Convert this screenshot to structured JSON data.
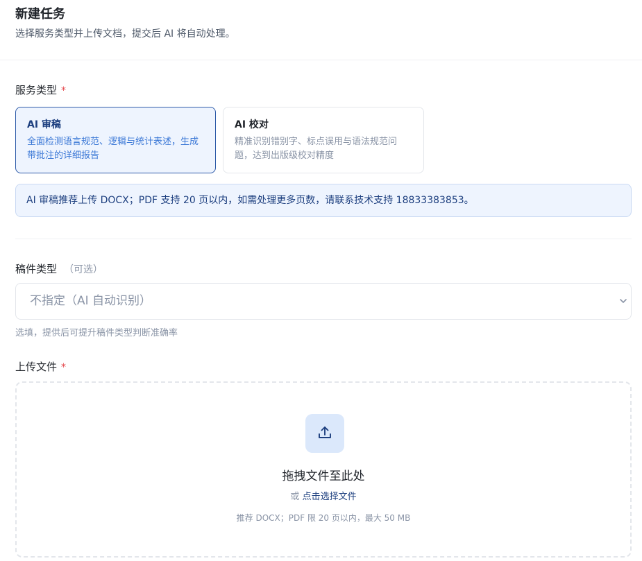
{
  "header": {
    "title": "新建任务",
    "subtitle": "选择服务类型并上传文档，提交后 AI 将自动处理。"
  },
  "service": {
    "label": "服务类型",
    "required_mark": "*",
    "options": [
      {
        "title": "AI 审稿",
        "desc": "全面检测语言规范、逻辑与统计表述，生成带批注的详细报告",
        "selected": true
      },
      {
        "title": "AI 校对",
        "desc": "精准识别错别字、标点误用与语法规范问题，达到出版级校对精度",
        "selected": false
      }
    ],
    "notice": "AI 审稿推荐上传 DOCX；PDF 支持 20 页以内，如需处理更多页数，请联系技术支持 18833383853。"
  },
  "manuscript": {
    "label": "稿件类型",
    "optional_mark": "（可选）",
    "select_value": "不指定（AI 自动识别）",
    "hint": "选填，提供后可提升稿件类型判断准确率"
  },
  "upload": {
    "label": "上传文件",
    "required_mark": "*",
    "drop_text": "拖拽文件至此处",
    "or_text": "或",
    "choose_link": "点击选择文件",
    "limit_text": "推荐 DOCX；PDF 限 20 页以内，最大 50 MB"
  },
  "icons": {
    "upload": "upload-icon",
    "chevron": "chevron-down-icon"
  },
  "colors": {
    "accent": "#1d3f7f",
    "selected_border": "#2d5aa8",
    "selected_bg": "#eef4fe",
    "required": "#e5484d",
    "muted": "#8a94a6"
  }
}
